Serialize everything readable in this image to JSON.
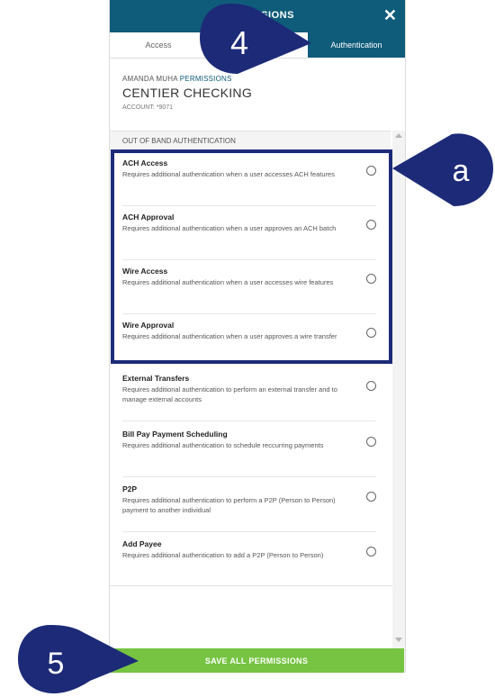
{
  "header": {
    "title": "PERMISSIONS",
    "close_label": "✕"
  },
  "tabs": [
    {
      "label": "Access"
    },
    {
      "label": "Authentication"
    }
  ],
  "user": {
    "name": "AMANDA MUHA",
    "permissions_label": "PERMISSIONS"
  },
  "product": {
    "name": "CENTIER CHECKING",
    "account": "ACCOUNT: *9071"
  },
  "section": {
    "title": "OUT OF BAND AUTHENTICATION"
  },
  "items": [
    {
      "title": "ACH Access",
      "desc": "Requires additional authentication when a user accesses ACH features"
    },
    {
      "title": "ACH Approval",
      "desc": "Requires additional authentication when a user approves an ACH batch"
    },
    {
      "title": "Wire Access",
      "desc": "Requires additional authentication when a user accesses wire features"
    },
    {
      "title": "Wire Approval",
      "desc": "Requires additional authentication when a user approves a wire transfer"
    },
    {
      "title": "External Transfers",
      "desc": "Requires additional authentication to perform an external transfer and to manage external accounts"
    },
    {
      "title": "Bill Pay Payment Scheduling",
      "desc": "Requires additional authentication to schedule reccurring payments"
    },
    {
      "title": "P2P",
      "desc": "Requires additional authentication to perform a P2P (Person to Person) payment to another individual"
    },
    {
      "title": "Add Payee",
      "desc": "Requires additional authentication to add a P2P (Person to Person)"
    }
  ],
  "save_button": {
    "label": "SAVE ALL PERMISSIONS",
    "color": "#76c442"
  },
  "callouts": {
    "c4": "4",
    "ca": "a",
    "c5": "5",
    "color": "#1c2a78"
  },
  "colors": {
    "header_bg": "#0f5c7a"
  }
}
